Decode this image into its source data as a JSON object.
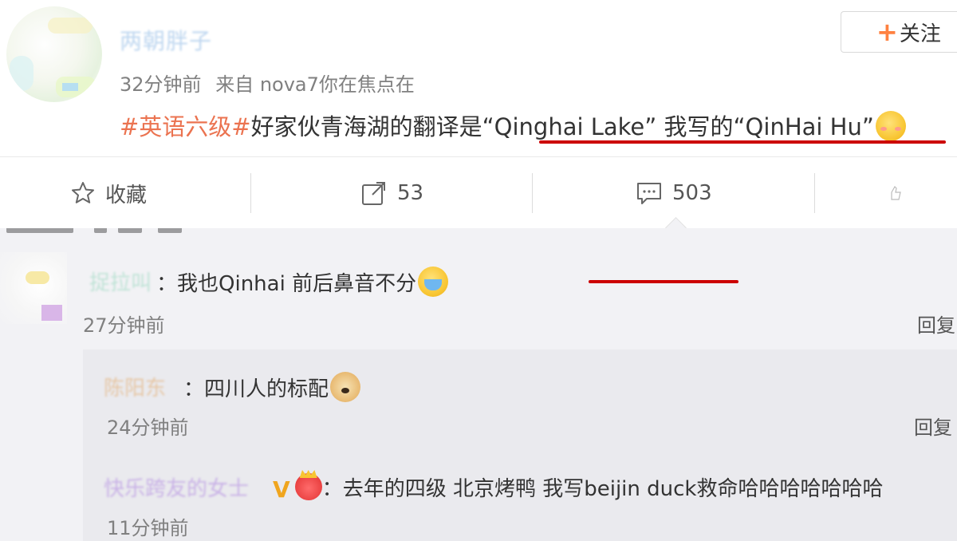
{
  "post": {
    "username": "两朝胖子",
    "follow_label": "关注",
    "time": "32分钟前",
    "source": "来自 nova7你在焦点在",
    "hashtag": "#英语六级#",
    "text_before": "好家伙青海湖的翻译是",
    "quote_official": "“Qinghai Lake”",
    "text_mid": " 我写的",
    "quote_mine": "“QinHai Hu”",
    "emoji": "blush-smile-emoji"
  },
  "actions": {
    "favorite_label": "收藏",
    "repost_count": "53",
    "comment_count": "503"
  },
  "comments": [
    {
      "name": "捉拉叫",
      "separator": "：",
      "text": "我也Qinhai  前后鼻音不分",
      "emoji": "cry-emoji",
      "time": "27分钟前",
      "reply_label": "回复"
    }
  ],
  "replies": [
    {
      "name": "陈阳东",
      "separator": "：",
      "text": "四川人的标配",
      "emoji": "doge-emoji",
      "time": "24分钟前",
      "reply_label": "回复"
    },
    {
      "name": "快乐跨友的女士",
      "badge": "V",
      "separator": "：",
      "text": "去年的四级 北京烤鸭 我写beijin duck救命哈哈哈哈哈哈哈",
      "time": "11分钟前"
    }
  ],
  "colors": {
    "hashtag": "#eb7350",
    "follow_plus": "#ff8140",
    "annotation_red": "#cc0000",
    "comment_bg": "#f2f2f5",
    "reply_bg": "#eaeaee"
  }
}
